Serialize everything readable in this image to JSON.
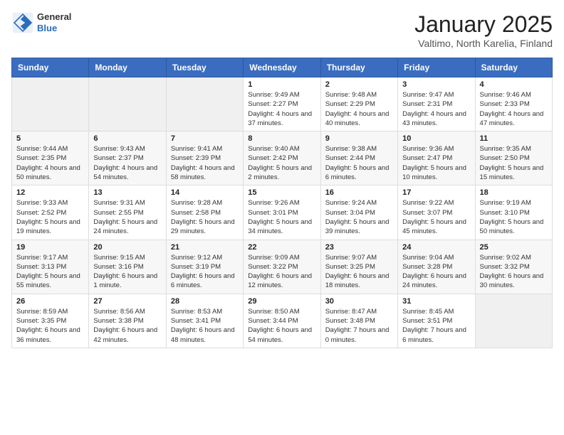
{
  "header": {
    "logo_general": "General",
    "logo_blue": "Blue",
    "month_title": "January 2025",
    "location": "Valtimo, North Karelia, Finland"
  },
  "weekdays": [
    "Sunday",
    "Monday",
    "Tuesday",
    "Wednesday",
    "Thursday",
    "Friday",
    "Saturday"
  ],
  "weeks": [
    [
      {
        "day": "",
        "info": ""
      },
      {
        "day": "",
        "info": ""
      },
      {
        "day": "",
        "info": ""
      },
      {
        "day": "1",
        "info": "Sunrise: 9:49 AM\nSunset: 2:27 PM\nDaylight: 4 hours and 37 minutes."
      },
      {
        "day": "2",
        "info": "Sunrise: 9:48 AM\nSunset: 2:29 PM\nDaylight: 4 hours and 40 minutes."
      },
      {
        "day": "3",
        "info": "Sunrise: 9:47 AM\nSunset: 2:31 PM\nDaylight: 4 hours and 43 minutes."
      },
      {
        "day": "4",
        "info": "Sunrise: 9:46 AM\nSunset: 2:33 PM\nDaylight: 4 hours and 47 minutes."
      }
    ],
    [
      {
        "day": "5",
        "info": "Sunrise: 9:44 AM\nSunset: 2:35 PM\nDaylight: 4 hours and 50 minutes."
      },
      {
        "day": "6",
        "info": "Sunrise: 9:43 AM\nSunset: 2:37 PM\nDaylight: 4 hours and 54 minutes."
      },
      {
        "day": "7",
        "info": "Sunrise: 9:41 AM\nSunset: 2:39 PM\nDaylight: 4 hours and 58 minutes."
      },
      {
        "day": "8",
        "info": "Sunrise: 9:40 AM\nSunset: 2:42 PM\nDaylight: 5 hours and 2 minutes."
      },
      {
        "day": "9",
        "info": "Sunrise: 9:38 AM\nSunset: 2:44 PM\nDaylight: 5 hours and 6 minutes."
      },
      {
        "day": "10",
        "info": "Sunrise: 9:36 AM\nSunset: 2:47 PM\nDaylight: 5 hours and 10 minutes."
      },
      {
        "day": "11",
        "info": "Sunrise: 9:35 AM\nSunset: 2:50 PM\nDaylight: 5 hours and 15 minutes."
      }
    ],
    [
      {
        "day": "12",
        "info": "Sunrise: 9:33 AM\nSunset: 2:52 PM\nDaylight: 5 hours and 19 minutes."
      },
      {
        "day": "13",
        "info": "Sunrise: 9:31 AM\nSunset: 2:55 PM\nDaylight: 5 hours and 24 minutes."
      },
      {
        "day": "14",
        "info": "Sunrise: 9:28 AM\nSunset: 2:58 PM\nDaylight: 5 hours and 29 minutes."
      },
      {
        "day": "15",
        "info": "Sunrise: 9:26 AM\nSunset: 3:01 PM\nDaylight: 5 hours and 34 minutes."
      },
      {
        "day": "16",
        "info": "Sunrise: 9:24 AM\nSunset: 3:04 PM\nDaylight: 5 hours and 39 minutes."
      },
      {
        "day": "17",
        "info": "Sunrise: 9:22 AM\nSunset: 3:07 PM\nDaylight: 5 hours and 45 minutes."
      },
      {
        "day": "18",
        "info": "Sunrise: 9:19 AM\nSunset: 3:10 PM\nDaylight: 5 hours and 50 minutes."
      }
    ],
    [
      {
        "day": "19",
        "info": "Sunrise: 9:17 AM\nSunset: 3:13 PM\nDaylight: 5 hours and 55 minutes."
      },
      {
        "day": "20",
        "info": "Sunrise: 9:15 AM\nSunset: 3:16 PM\nDaylight: 6 hours and 1 minute."
      },
      {
        "day": "21",
        "info": "Sunrise: 9:12 AM\nSunset: 3:19 PM\nDaylight: 6 hours and 6 minutes."
      },
      {
        "day": "22",
        "info": "Sunrise: 9:09 AM\nSunset: 3:22 PM\nDaylight: 6 hours and 12 minutes."
      },
      {
        "day": "23",
        "info": "Sunrise: 9:07 AM\nSunset: 3:25 PM\nDaylight: 6 hours and 18 minutes."
      },
      {
        "day": "24",
        "info": "Sunrise: 9:04 AM\nSunset: 3:28 PM\nDaylight: 6 hours and 24 minutes."
      },
      {
        "day": "25",
        "info": "Sunrise: 9:02 AM\nSunset: 3:32 PM\nDaylight: 6 hours and 30 minutes."
      }
    ],
    [
      {
        "day": "26",
        "info": "Sunrise: 8:59 AM\nSunset: 3:35 PM\nDaylight: 6 hours and 36 minutes."
      },
      {
        "day": "27",
        "info": "Sunrise: 8:56 AM\nSunset: 3:38 PM\nDaylight: 6 hours and 42 minutes."
      },
      {
        "day": "28",
        "info": "Sunrise: 8:53 AM\nSunset: 3:41 PM\nDaylight: 6 hours and 48 minutes."
      },
      {
        "day": "29",
        "info": "Sunrise: 8:50 AM\nSunset: 3:44 PM\nDaylight: 6 hours and 54 minutes."
      },
      {
        "day": "30",
        "info": "Sunrise: 8:47 AM\nSunset: 3:48 PM\nDaylight: 7 hours and 0 minutes."
      },
      {
        "day": "31",
        "info": "Sunrise: 8:45 AM\nSunset: 3:51 PM\nDaylight: 7 hours and 6 minutes."
      },
      {
        "day": "",
        "info": ""
      }
    ]
  ]
}
